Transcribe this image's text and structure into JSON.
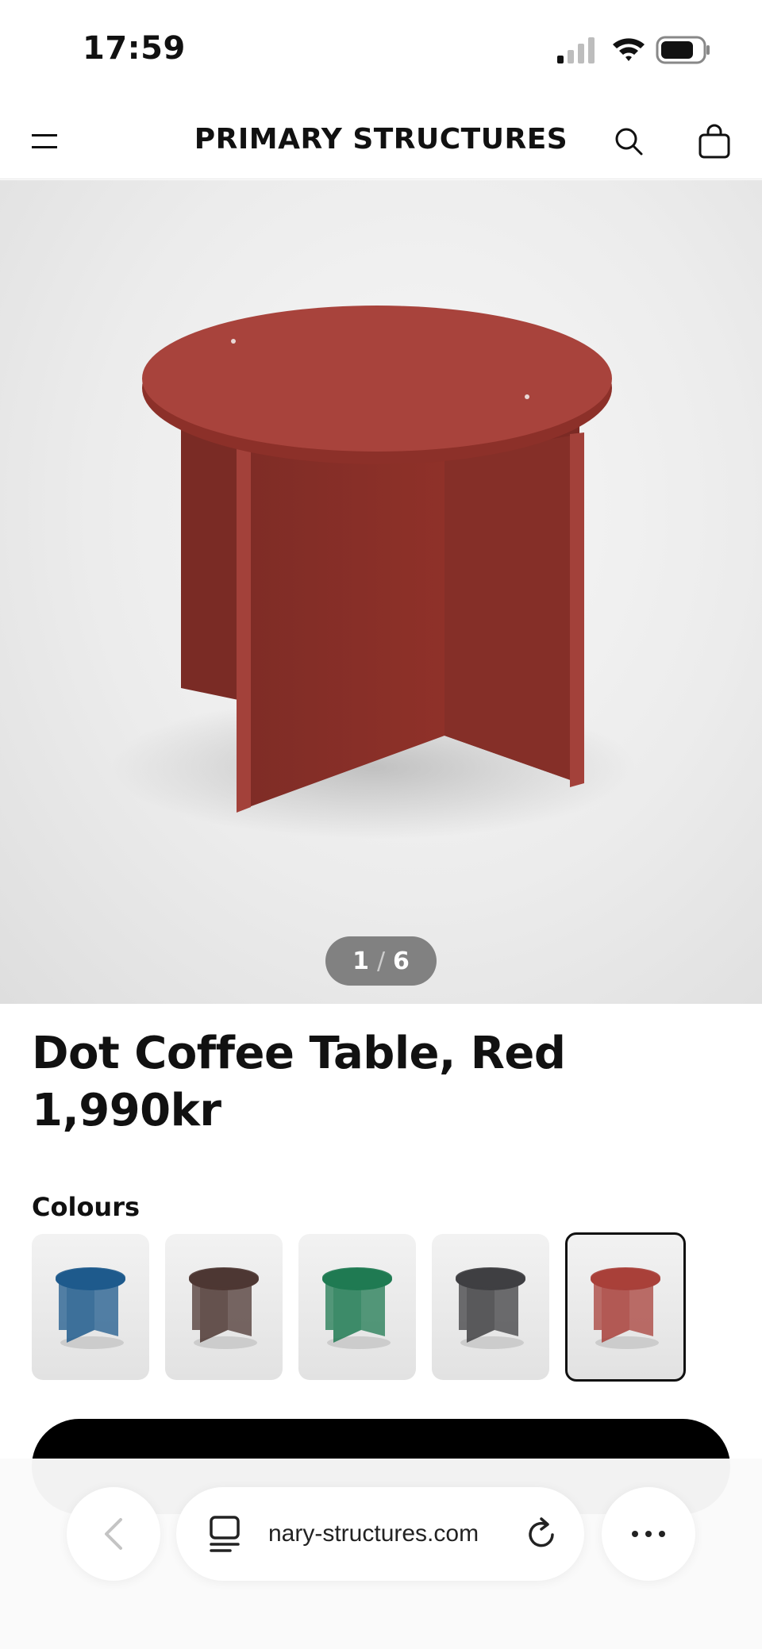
{
  "status_bar": {
    "time": "17:59"
  },
  "header": {
    "brand": "PRIMARY STRUCTURES",
    "icons": [
      "menu-icon",
      "search-icon",
      "shopping-bag-icon"
    ]
  },
  "gallery": {
    "current": "1",
    "separator": "/",
    "total": "6",
    "main_color": "#a0403a"
  },
  "product": {
    "title": "Dot Coffee Table, Red",
    "price": "1,990kr"
  },
  "colours": {
    "label": "Colours",
    "options": [
      {
        "name": "blue",
        "color": "#1e5a8c",
        "selected": false
      },
      {
        "name": "brown",
        "color": "#4e3733",
        "selected": false
      },
      {
        "name": "green",
        "color": "#1f7a52",
        "selected": false
      },
      {
        "name": "grey",
        "color": "#3f3f42",
        "selected": false
      },
      {
        "name": "red",
        "color": "#a8403a",
        "selected": true
      }
    ]
  },
  "browser": {
    "url": "nary-structures.com",
    "icons": [
      "back-chevron-icon",
      "tabs-icon",
      "reload-icon",
      "more-dots-icon"
    ]
  }
}
